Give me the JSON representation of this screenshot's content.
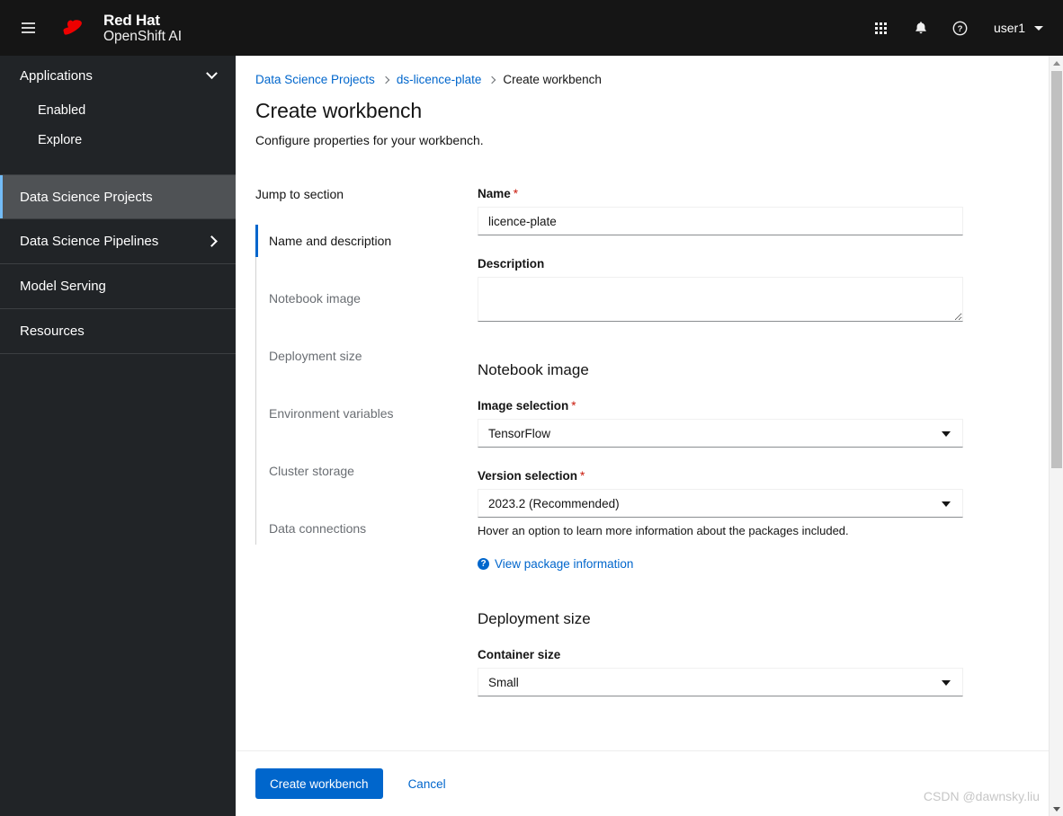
{
  "masthead": {
    "menu_toggle": "hamburger-menu",
    "brand_line1": "Red Hat",
    "brand_line2": "OpenShift AI",
    "apps_icon": "grid-icon",
    "notifications_icon": "bell-icon",
    "help_icon": "help-icon",
    "username": "user1"
  },
  "sidebar": {
    "group": {
      "label": "Applications",
      "expanded": true,
      "children": [
        {
          "label": "Enabled"
        },
        {
          "label": "Explore"
        }
      ]
    },
    "items": [
      {
        "label": "Data Science Projects",
        "active": true,
        "has_chevron": false
      },
      {
        "label": "Data Science Pipelines",
        "active": false,
        "has_chevron": true
      },
      {
        "label": "Model Serving",
        "active": false,
        "has_chevron": false
      },
      {
        "label": "Resources",
        "active": false,
        "has_chevron": false
      }
    ]
  },
  "breadcrumb": {
    "items": [
      {
        "label": "Data Science Projects",
        "link": true
      },
      {
        "label": "ds-licence-plate",
        "link": true
      },
      {
        "label": "Create workbench",
        "link": false
      }
    ]
  },
  "page": {
    "title": "Create workbench",
    "subtitle": "Configure properties for your workbench."
  },
  "jump_to_section": {
    "title": "Jump to section",
    "items": [
      {
        "label": "Name and description",
        "active": true
      },
      {
        "label": "Notebook image",
        "active": false
      },
      {
        "label": "Deployment size",
        "active": false
      },
      {
        "label": "Environment variables",
        "active": false
      },
      {
        "label": "Cluster storage",
        "active": false
      },
      {
        "label": "Data connections",
        "active": false
      }
    ]
  },
  "form": {
    "name": {
      "label": "Name",
      "required": "*",
      "value": "licence-plate",
      "placeholder": ""
    },
    "description": {
      "label": "Description",
      "value": "",
      "placeholder": ""
    },
    "notebook_image": {
      "section_title": "Notebook image",
      "image_selection": {
        "label": "Image selection",
        "required": "*",
        "value": "TensorFlow"
      },
      "version_selection": {
        "label": "Version selection",
        "required": "*",
        "value": "2023.2 (Recommended)",
        "helper": "Hover an option to learn more information about the packages included."
      },
      "package_link": "View package information"
    },
    "deployment_size": {
      "section_title": "Deployment size",
      "container_size": {
        "label": "Container size",
        "value": "Small"
      }
    }
  },
  "footer": {
    "submit_label": "Create workbench",
    "cancel_label": "Cancel"
  },
  "watermark": "CSDN @dawnsky.liu",
  "colors": {
    "brand_red": "#ee0000",
    "masthead_bg": "#151515",
    "sidebar_bg": "#212427",
    "sidebar_active_bg": "#4f5255",
    "sidebar_active_accent": "#73bcf7",
    "link_blue": "#06c",
    "required_red": "#c9190b"
  }
}
